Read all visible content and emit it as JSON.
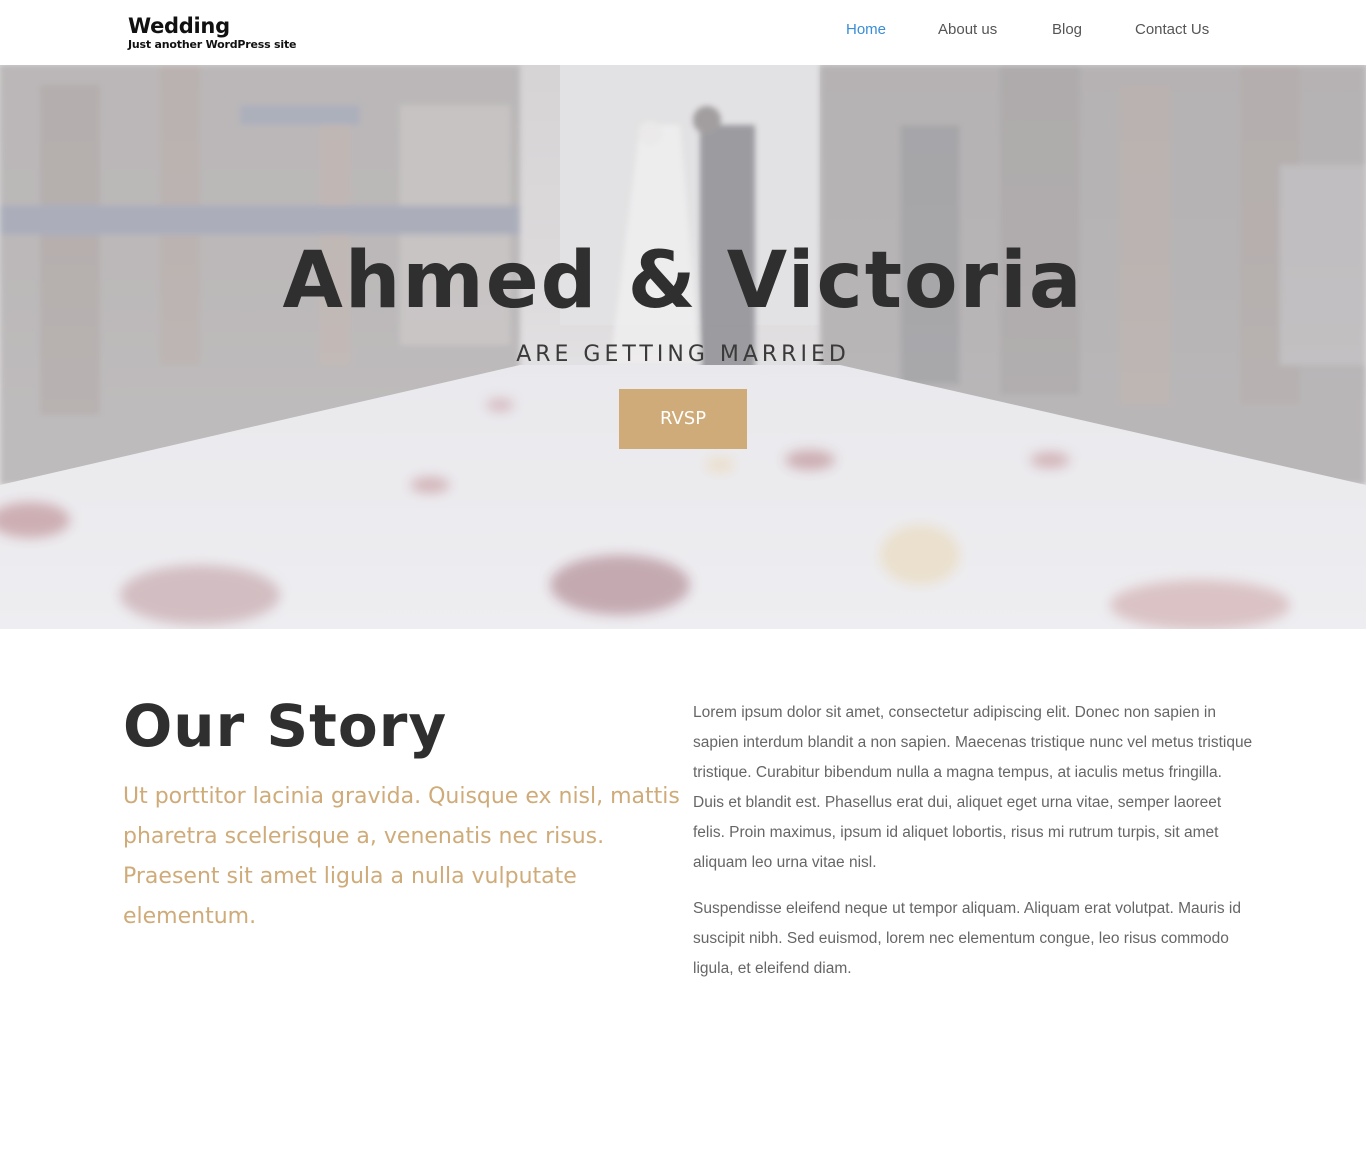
{
  "header": {
    "site_title": "Wedding",
    "tagline": "Just another WordPress site",
    "nav": [
      {
        "label": "Home",
        "active": true
      },
      {
        "label": "About us",
        "active": false
      },
      {
        "label": "Blog",
        "active": false
      },
      {
        "label": "Contact Us",
        "active": false
      }
    ]
  },
  "hero": {
    "title": "Ahmed & Victoria",
    "subtitle": "ARE GETTING MARRIED",
    "button_label": "RVSP"
  },
  "story": {
    "title": "Our Story",
    "lead": "Ut porttitor lacinia gravida. Quisque ex nisl, mattis pharetra scelerisque a, venenatis nec risus. Praesent sit amet ligula a nulla vulputate elementum.",
    "paragraphs": [
      "Lorem ipsum dolor sit amet, consectetur adipiscing elit. Donec non sapien in sapien interdum blandit a non sapien. Maecenas tristique nunc vel metus tristique tristique. Curabitur bibendum nulla a magna tempus, at iaculis metus fringilla. Duis et blandit est. Phasellus erat dui, aliquet eget urna vitae, semper laoreet felis. Proin maximus, ipsum id aliquet lobortis, risus mi rutrum turpis, sit amet aliquam leo urna vitae nisl.",
      "Suspendisse eleifend neque ut tempor aliquam. Aliquam erat volutpat. Mauris id suscipit nibh. Sed euismod, lorem nec elementum congue, leo risus commodo ligula, et eleifend diam."
    ]
  },
  "colors": {
    "accent": "#cfab79",
    "nav_active": "#3a8dd6",
    "text_dark": "#2f2f2f",
    "text_body": "#666666"
  }
}
